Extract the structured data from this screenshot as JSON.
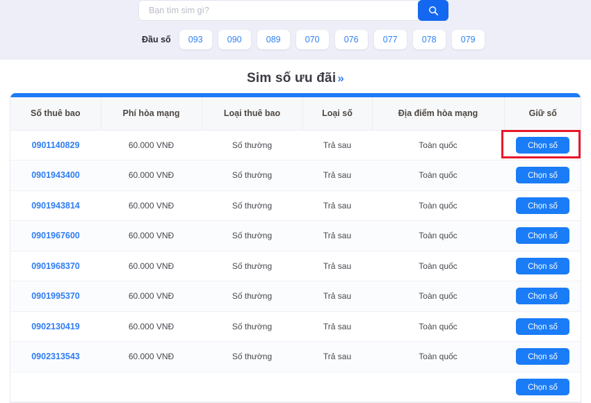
{
  "search": {
    "placeholder": "Bạn tìm sim gì?",
    "value": "",
    "button_icon": "search-icon"
  },
  "prefix_filter": {
    "label": "Đầu số",
    "options": [
      "093",
      "090",
      "089",
      "070",
      "076",
      "077",
      "078",
      "079"
    ]
  },
  "section": {
    "title": "Sim số ưu đãi",
    "arrows": "»"
  },
  "table": {
    "columns": [
      "Số thuê bao",
      "Phí hòa mạng",
      "Loại thuê bao",
      "Loại số",
      "Địa điểm hòa mạng",
      "Giữ số"
    ],
    "action_label": "Chọn số",
    "rows": [
      {
        "phone": "0901140829",
        "fee": "60.000 VNĐ",
        "sub_type": "Số thường",
        "num_type": "Trả sau",
        "location": "Toàn quốc",
        "action": "Chọn số"
      },
      {
        "phone": "0901943400",
        "fee": "60.000 VNĐ",
        "sub_type": "Số thường",
        "num_type": "Trả sau",
        "location": "Toàn quốc",
        "action": "Chọn số"
      },
      {
        "phone": "0901943814",
        "fee": "60.000 VNĐ",
        "sub_type": "Số thường",
        "num_type": "Trả sau",
        "location": "Toàn quốc",
        "action": "Chọn số"
      },
      {
        "phone": "0901967600",
        "fee": "60.000 VNĐ",
        "sub_type": "Số thường",
        "num_type": "Trả sau",
        "location": "Toàn quốc",
        "action": "Chọn số"
      },
      {
        "phone": "0901968370",
        "fee": "60.000 VNĐ",
        "sub_type": "Số thường",
        "num_type": "Trả sau",
        "location": "Toàn quốc",
        "action": "Chọn số"
      },
      {
        "phone": "0901995370",
        "fee": "60.000 VNĐ",
        "sub_type": "Số thường",
        "num_type": "Trả sau",
        "location": "Toàn quốc",
        "action": "Chọn số"
      },
      {
        "phone": "0902130419",
        "fee": "60.000 VNĐ",
        "sub_type": "Số thường",
        "num_type": "Trả sau",
        "location": "Toàn quốc",
        "action": "Chọn số"
      },
      {
        "phone": "0902313543",
        "fee": "60.000 VNĐ",
        "sub_type": "Số thường",
        "num_type": "Trả sau",
        "location": "Toàn quốc",
        "action": "Chọn số"
      },
      {
        "phone": "",
        "fee": "",
        "sub_type": "",
        "num_type": "",
        "location": "",
        "action": "Chọn số"
      }
    ]
  },
  "colors": {
    "accent": "#1a7cf7",
    "link": "#2f7df3",
    "banner_bg": "#edeef7",
    "header_bg": "#f7f8fa",
    "annotation": "#e8162a"
  }
}
